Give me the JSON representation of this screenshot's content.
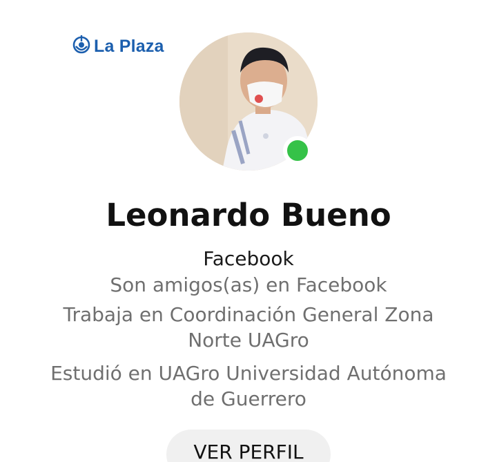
{
  "watermark": {
    "text": "La Plaza",
    "color": "#1c5fae"
  },
  "profile": {
    "name": "Leonardo Bueno",
    "online_status_color": "#35c248",
    "platform": "Facebook",
    "details": [
      "Son amigos(as) en Facebook",
      "Trabaja en Coordinación General Zona",
      "Norte UAGro",
      "Estudió en UAGro Universidad Autónoma",
      "de Guerrero"
    ]
  },
  "actions": {
    "view_profile_label": "VER PERFIL"
  }
}
